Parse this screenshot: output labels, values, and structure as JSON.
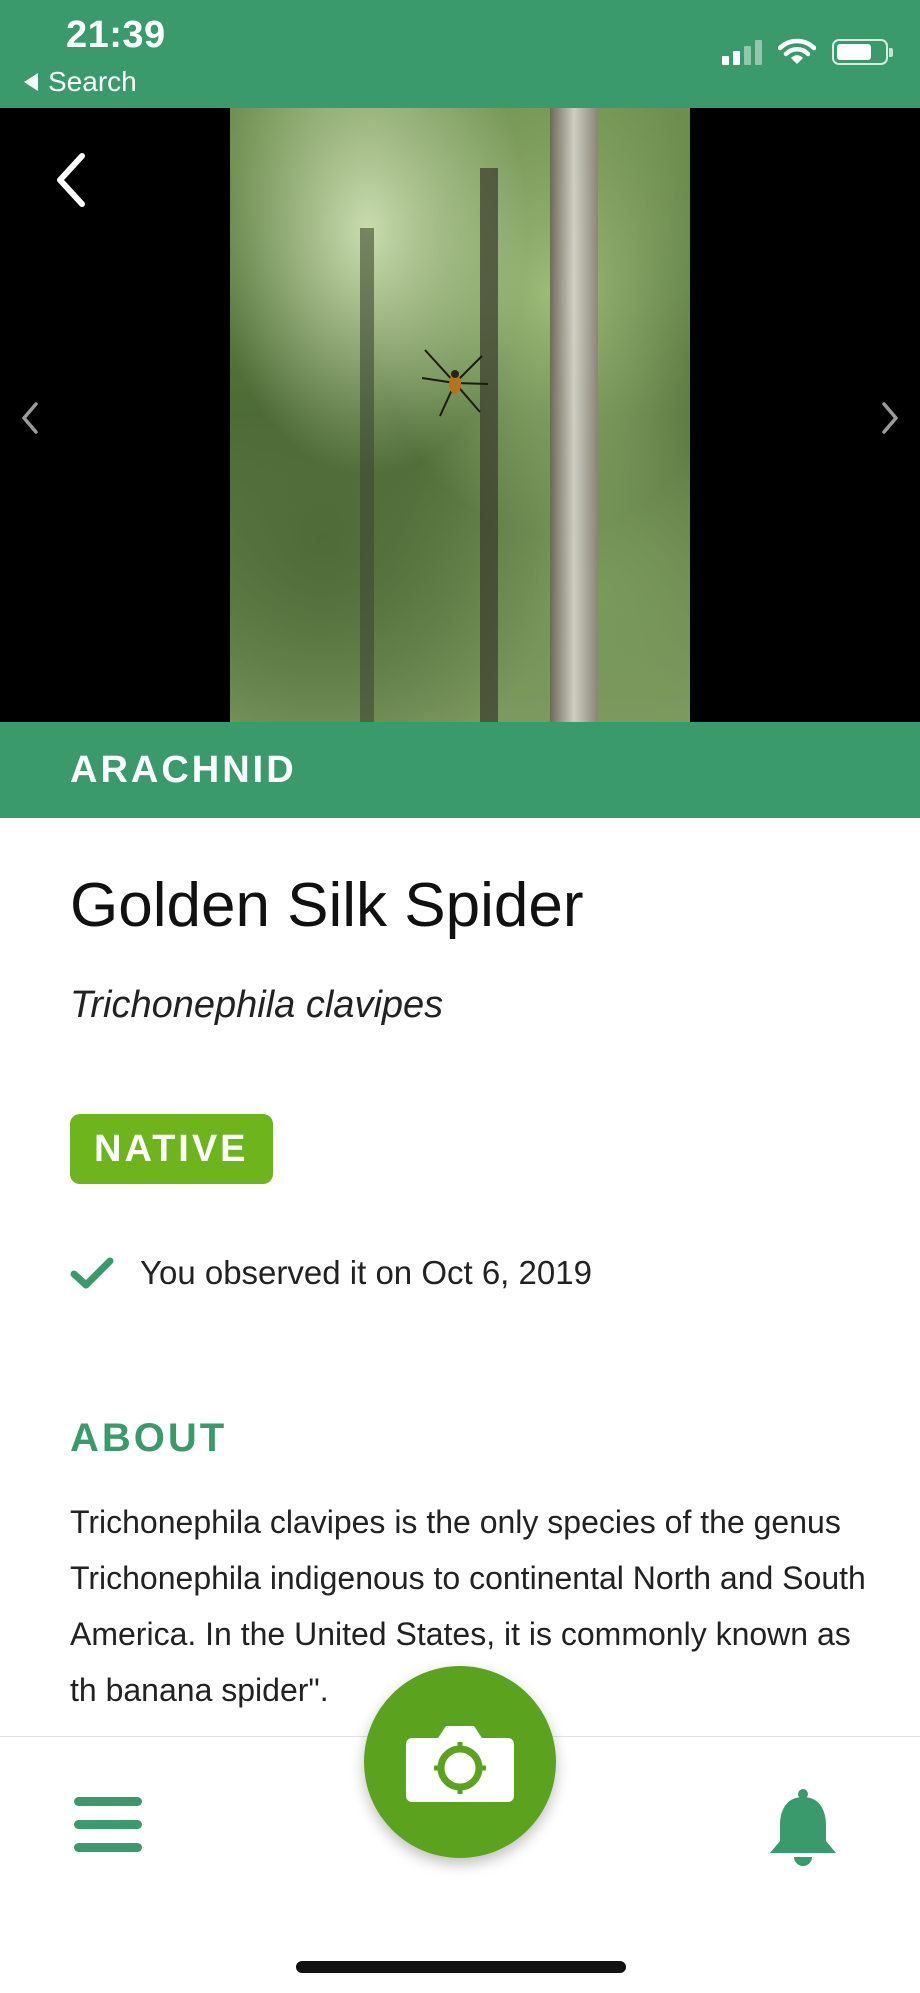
{
  "status_bar": {
    "time": "21:39",
    "back_app": "Search",
    "icons": [
      "signal-icon",
      "wifi-icon",
      "battery-icon"
    ]
  },
  "photo": {
    "subject": "spider photo",
    "icons": [
      "back-chevron-icon",
      "previous-photo-icon",
      "next-photo-icon"
    ]
  },
  "category": {
    "label": "ARACHNID"
  },
  "species": {
    "common_name": "Golden Silk Spider",
    "scientific_name": "Trichonephila clavipes",
    "status_badge": "NATIVE"
  },
  "observation": {
    "text": "You observed it on Oct 6, 2019"
  },
  "about": {
    "heading": "ABOUT",
    "text": "Trichonephila clavipes is the only species of the genus Trichonephila indigenous to continental North and South America. In the United States, it is commonly known as th banana spider\"."
  },
  "bottom_nav": {
    "icons": [
      "menu-icon",
      "camera-icon",
      "bell-icon"
    ]
  },
  "colors": {
    "primary_green": "#3a9a6c",
    "badge_green": "#6db41d",
    "fab_green": "#5ba31e"
  }
}
